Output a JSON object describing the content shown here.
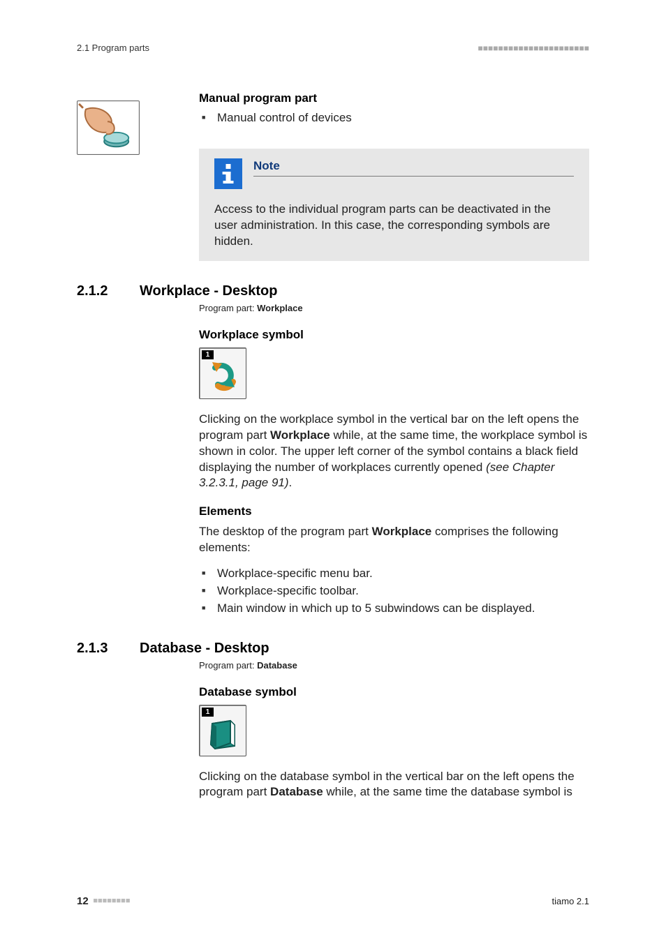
{
  "header": {
    "left": "2.1 Program parts",
    "squares": "■■■■■■■■■■■■■■■■■■■■■■"
  },
  "manual": {
    "heading": "Manual program part",
    "bullet1": "Manual control of devices"
  },
  "note": {
    "label": "Note",
    "body": "Access to the individual program parts can be deactivated in the user administration. In this case, the corresponding symbols are hidden."
  },
  "sec212": {
    "num": "2.1.2",
    "title": "Workplace - Desktop",
    "sub_prefix": "Program part: ",
    "sub_bold": "Workplace",
    "h_symbol": "Workplace symbol",
    "badge": "1",
    "para1_a": "Clicking on the workplace symbol in the vertical bar on the left opens the program part ",
    "para1_b": "Workplace",
    "para1_c": " while, at the same time, the workplace symbol is shown in color. The upper left corner of the symbol contains a black field displaying the number of workplaces currently opened ",
    "para1_ref": "(see Chapter 3.2.3.1, page 91)",
    "para1_end": ".",
    "h_elements": "Elements",
    "elements_intro_a": "The desktop of the program part ",
    "elements_intro_b": "Workplace",
    "elements_intro_c": " comprises the following elements:",
    "li1": "Workplace-specific menu bar.",
    "li2": "Workplace-specific toolbar.",
    "li3": "Main window in which up to 5 subwindows can be displayed."
  },
  "sec213": {
    "num": "2.1.3",
    "title": "Database - Desktop",
    "sub_prefix": "Program part: ",
    "sub_bold": "Database",
    "h_symbol": "Database symbol",
    "badge": "1",
    "para1_a": "Clicking on the database symbol in the vertical bar on the left opens the program part ",
    "para1_b": "Database",
    "para1_c": " while, at the same time the database symbol is"
  },
  "footer": {
    "page": "12",
    "squares": "■■■■■■■■",
    "product": "tiamo 2.1"
  }
}
